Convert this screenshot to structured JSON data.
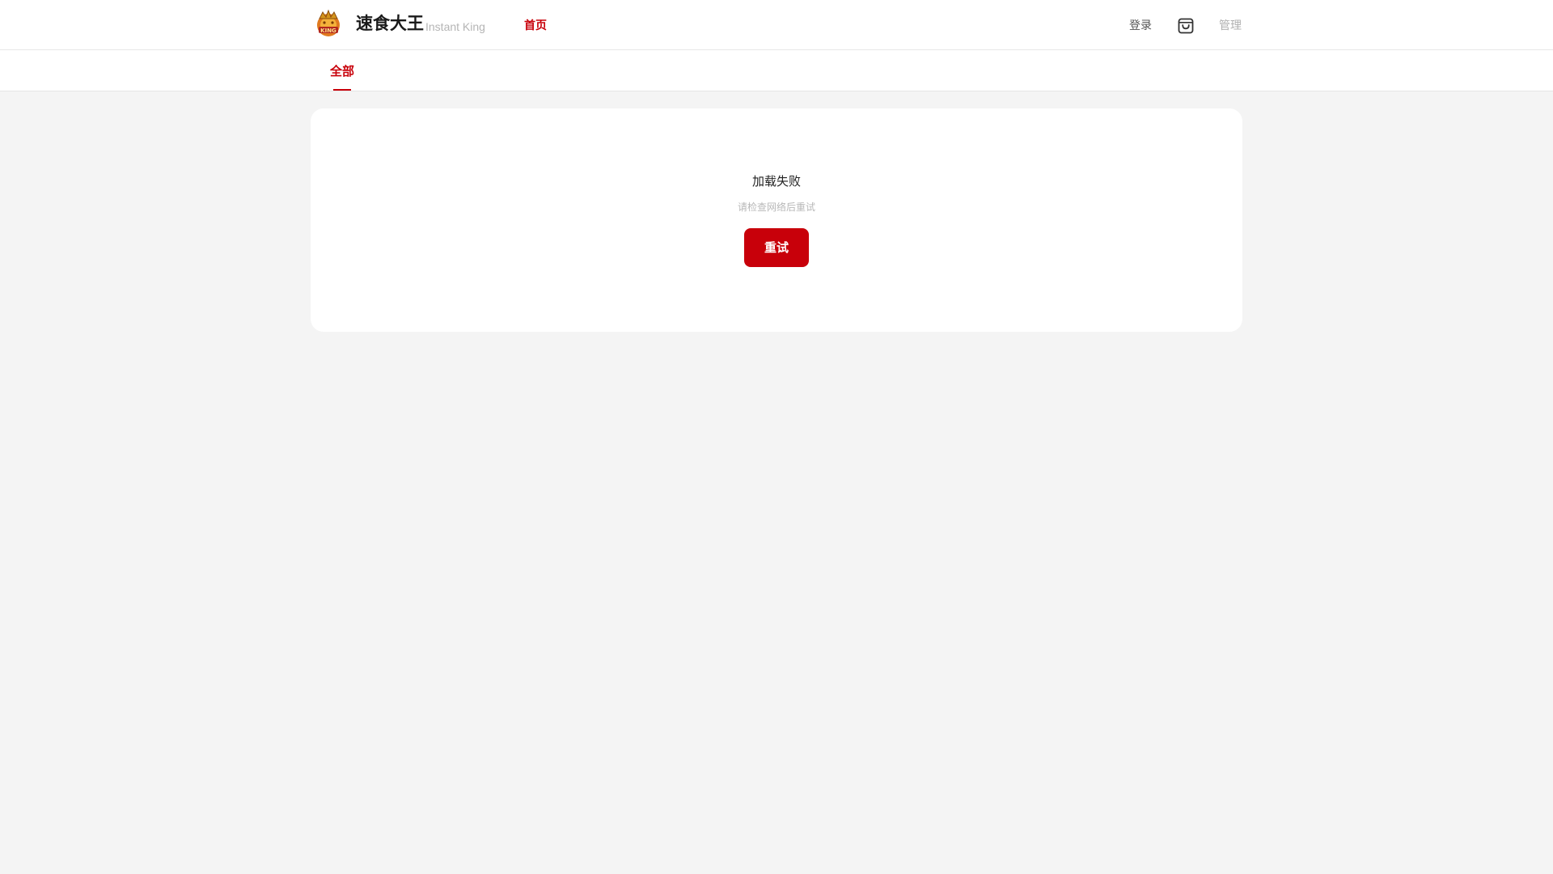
{
  "header": {
    "brand_name": "速食大王",
    "brand_subtitle": "Instant King",
    "logo_icon": "king-crown-logo",
    "nav_home": "首页",
    "nav_login": "登录",
    "cart_icon": "shopping-bag-icon",
    "nav_admin": "管理"
  },
  "tabs": {
    "active": "全部"
  },
  "error_state": {
    "title": "加载失败",
    "subtitle": "请检查网络后重试",
    "retry_label": "重试"
  },
  "colors": {
    "accent": "#c8000a",
    "page_background": "#f4f4f4",
    "card_background": "#ffffff"
  }
}
